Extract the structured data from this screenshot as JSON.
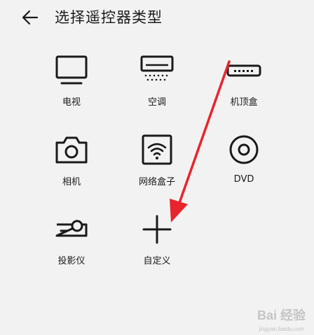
{
  "header": {
    "back_icon": "arrow-left-icon",
    "title": "选择遥控器类型"
  },
  "devices": [
    {
      "label": "电视",
      "icon": "tv-icon"
    },
    {
      "label": "空调",
      "icon": "air-conditioner-icon"
    },
    {
      "label": "机顶盒",
      "icon": "set-top-box-icon"
    },
    {
      "label": "相机",
      "icon": "camera-icon"
    },
    {
      "label": "网络盒子",
      "icon": "network-box-icon"
    },
    {
      "label": "DVD",
      "icon": "dvd-icon"
    },
    {
      "label": "投影仪",
      "icon": "projector-icon"
    },
    {
      "label": "自定义",
      "icon": "plus-icon"
    }
  ],
  "colors": {
    "background": "#f2f2f2",
    "icon": "#1a1a1a",
    "annotation_arrow": "#e8242c"
  },
  "watermark": {
    "text": "Bai 经验",
    "sub": "jingyan.baidu.com"
  }
}
